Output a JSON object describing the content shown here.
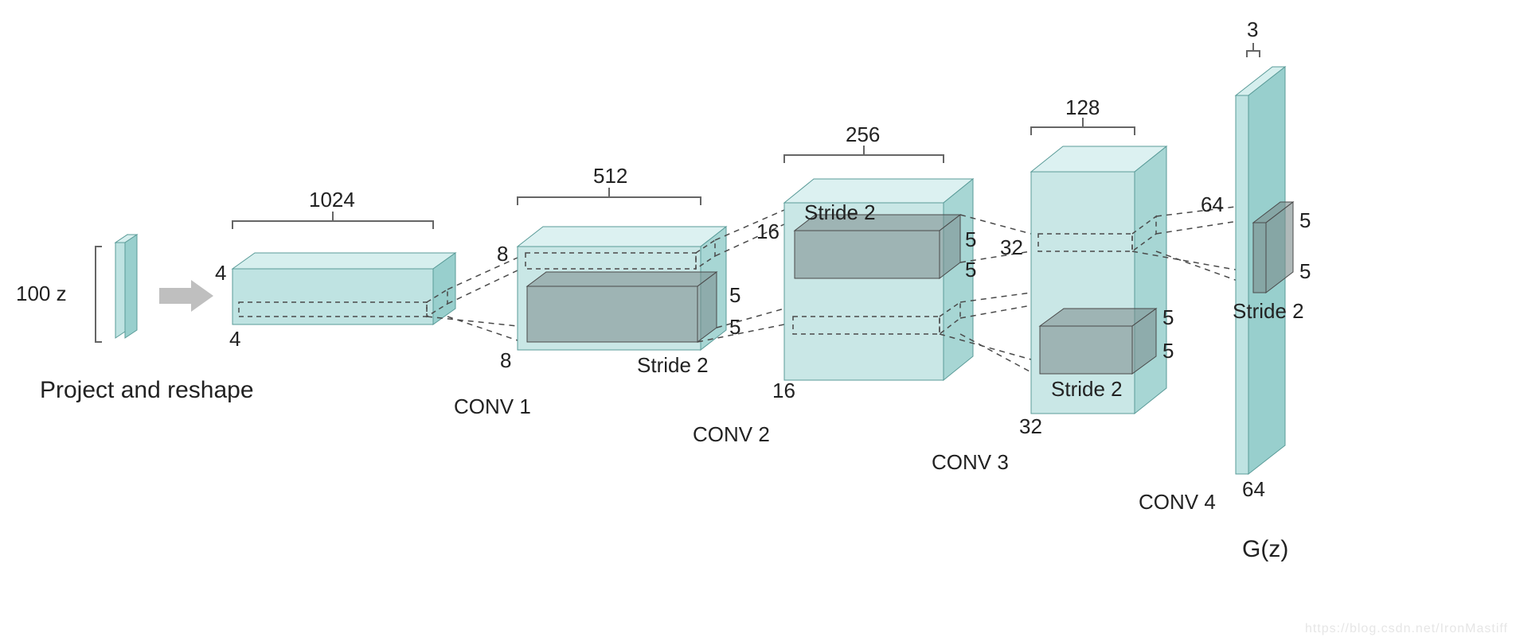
{
  "input": {
    "label": "100 z"
  },
  "reshape_label": "Project and reshape",
  "output_label": "G(z)",
  "watermark": "https://blog.csdn.net/IronMastiff",
  "layers": [
    {
      "name": "L0",
      "depth": "1024",
      "h": "4",
      "w": "4",
      "conv_label": "",
      "kernel": "",
      "stride": ""
    },
    {
      "name": "L1",
      "depth": "512",
      "h": "8",
      "w": "8",
      "conv_label": "CONV 1",
      "kernel": "5",
      "stride": "Stride 2"
    },
    {
      "name": "L2",
      "depth": "256",
      "h": "16",
      "w": "16",
      "conv_label": "CONV 2",
      "kernel": "5",
      "stride": "Stride 2"
    },
    {
      "name": "L3",
      "depth": "128",
      "h": "32",
      "w": "32",
      "conv_label": "CONV 3",
      "kernel": "5",
      "stride": "Stride 2"
    },
    {
      "name": "L4",
      "depth": "3",
      "h": "64",
      "w": "64",
      "conv_label": "CONV 4",
      "kernel": "5",
      "stride": "Stride 2"
    }
  ]
}
